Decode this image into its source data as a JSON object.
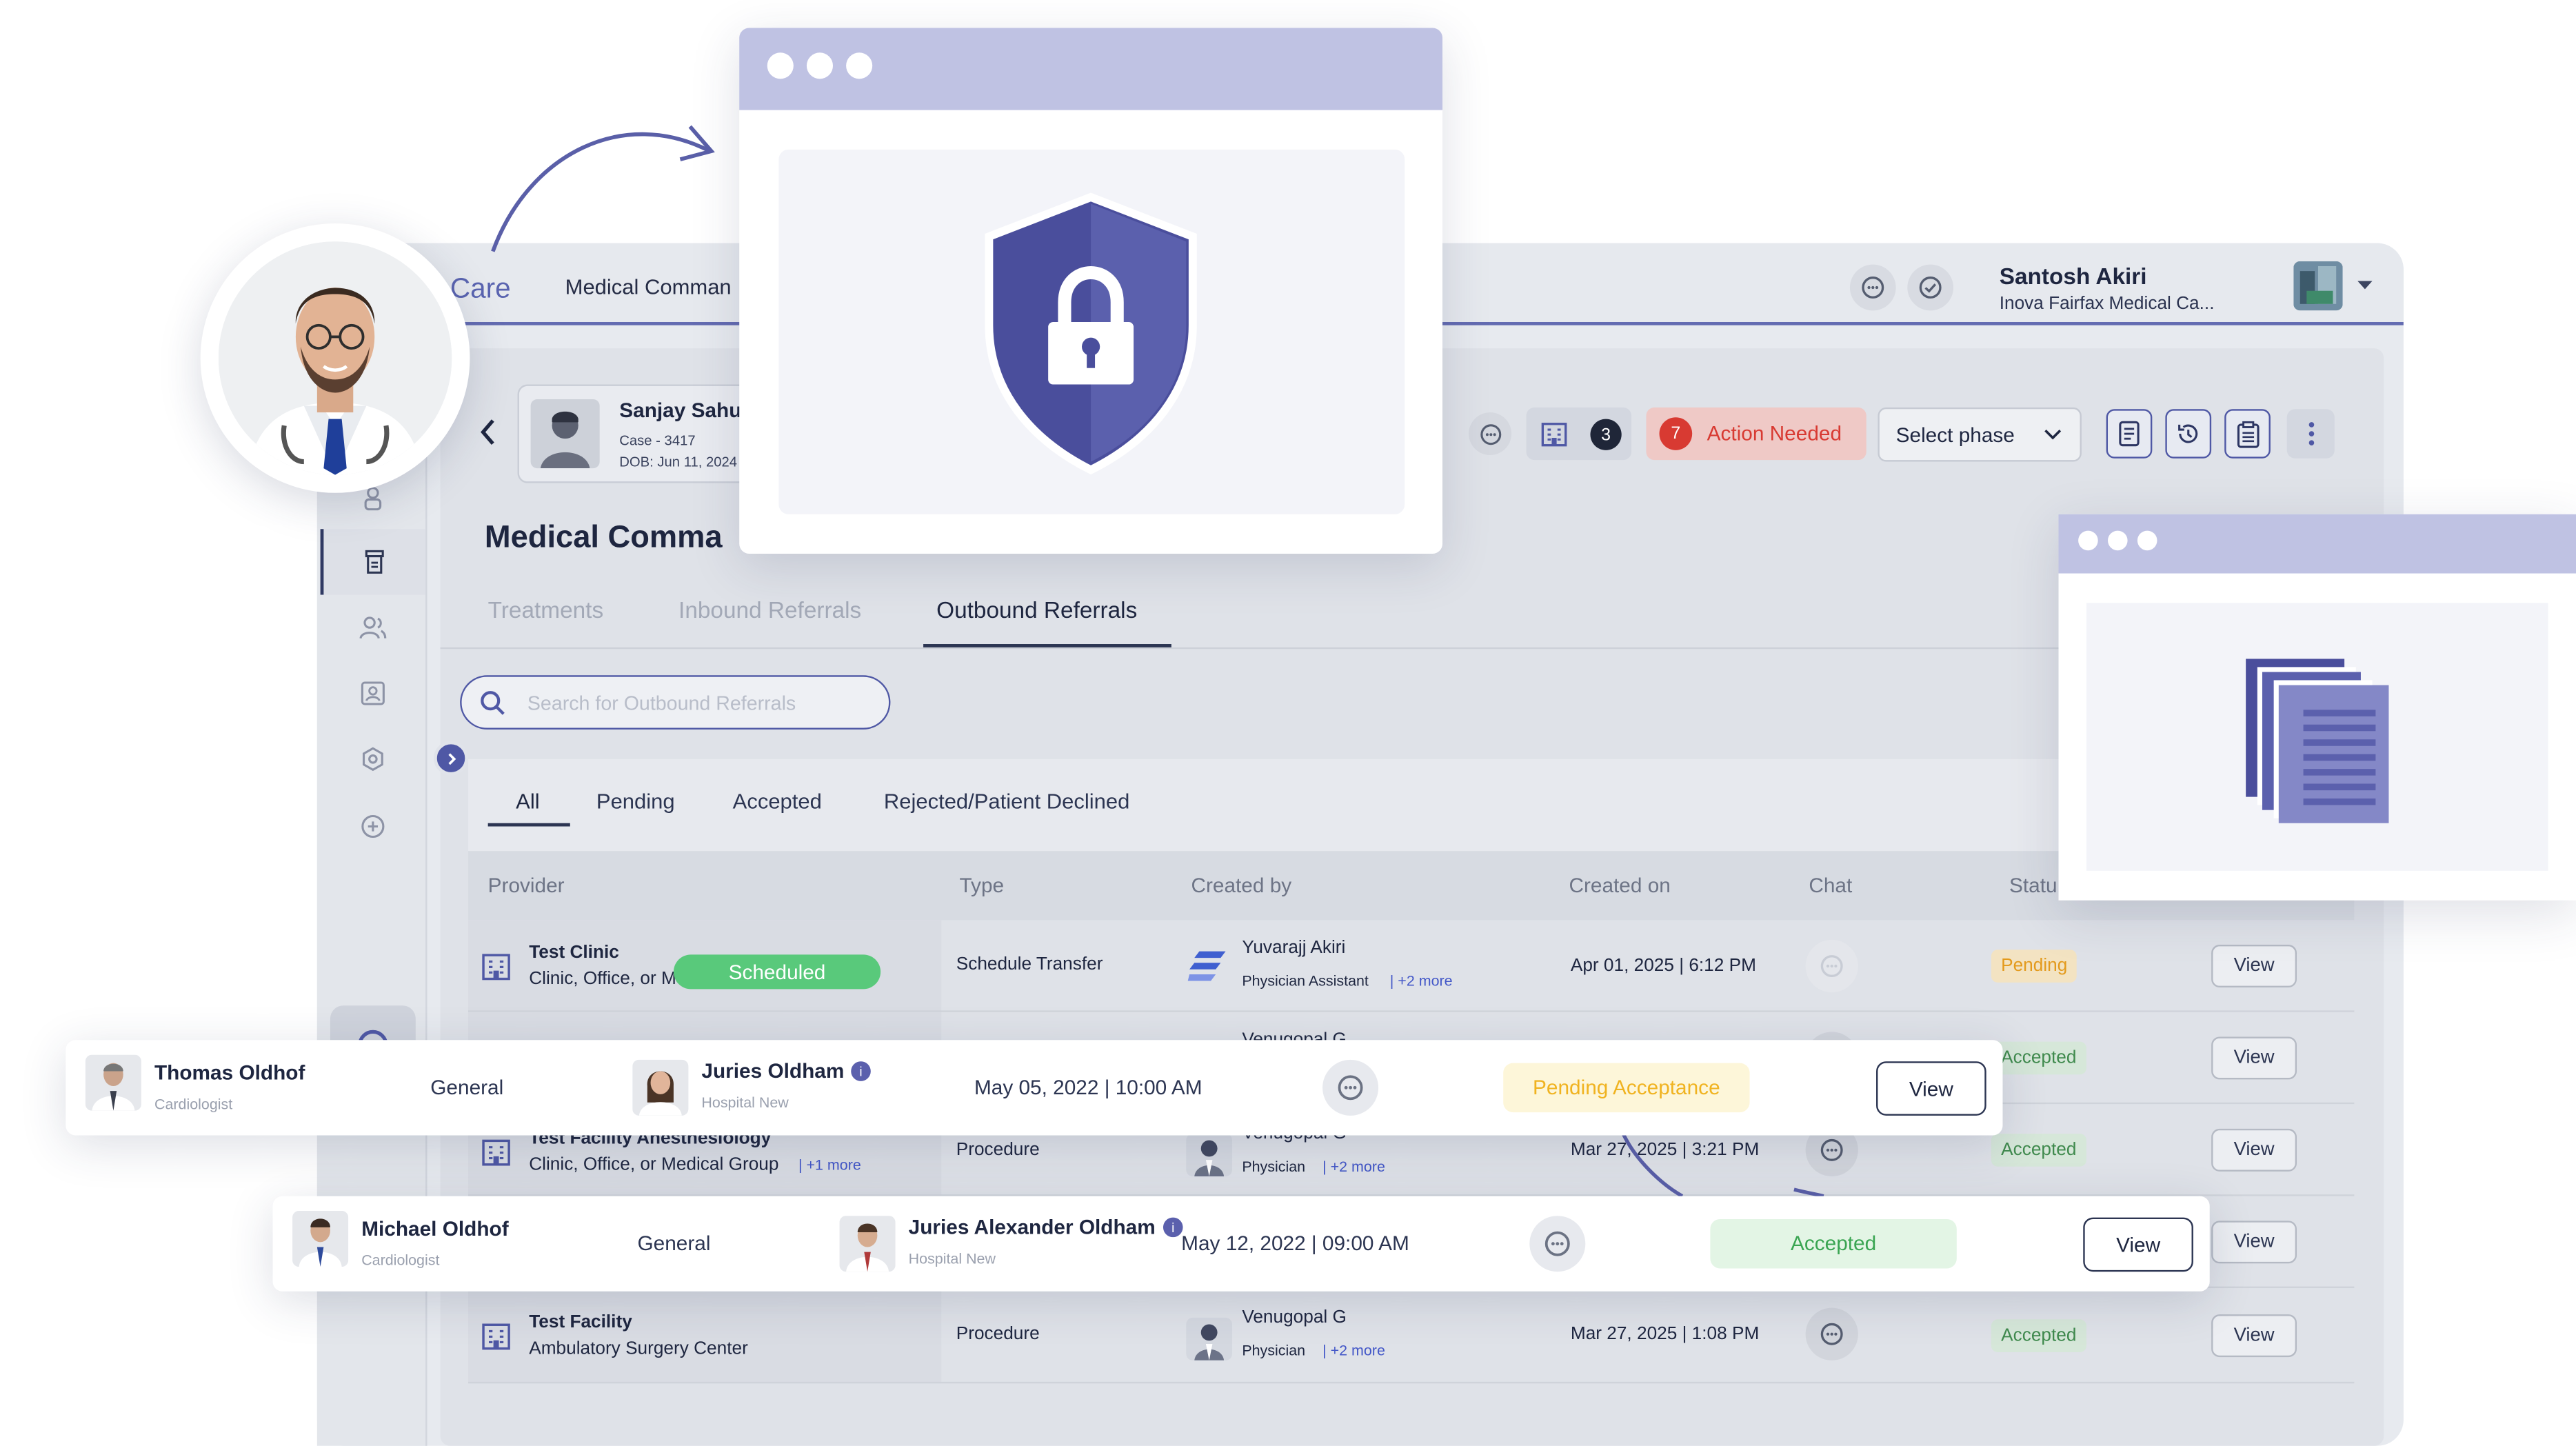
{
  "app": {
    "brand": "Care",
    "nav_title": "Medical Comman",
    "user": {
      "name": "Santosh Akiri",
      "org": "Inova Fairfax Medical Ca..."
    }
  },
  "patient": {
    "name": "Sanjay Sahu",
    "case": "Case - 3417",
    "dob": "DOB: Jun 11, 2024"
  },
  "toolbar": {
    "facility_count": "3",
    "action_count": "7",
    "action_label": "Action Needed",
    "phase_placeholder": "Select phase"
  },
  "page_title": "Medical Comma",
  "tabs": [
    "Treatments",
    "Inbound Referrals",
    "Outbound Referrals"
  ],
  "active_tab": "Outbound Referrals",
  "search": {
    "placeholder": "Search for Outbound Referrals"
  },
  "filters": [
    "All",
    "Pending",
    "Accepted",
    "Rejected/Patient Declined"
  ],
  "table": {
    "headers": [
      "Provider",
      "Type",
      "Created by",
      "Created on",
      "Chat",
      "Statu"
    ],
    "rows": [
      {
        "provider": "Test Clinic",
        "provider_type": "Clinic, Office, or M",
        "type": "Schedule Transfer",
        "created_by": "Yuvarajj Akiri",
        "role": "Physician Assistant",
        "more": "| +2 more",
        "created_on": "Apr 01, 2025 | 6:12 PM",
        "status": "Pending",
        "action": "View"
      },
      {
        "provider": "",
        "provider_type": "",
        "type": "",
        "created_by": "Venugopal G",
        "role": "",
        "more": "",
        "created_on": "",
        "status": "Accepted",
        "action": "View"
      },
      {
        "provider": "Test Facility Anesthesiology",
        "provider_type": "Clinic, Office, or Medical Group",
        "provider_more": "| +1 more",
        "type": "Procedure",
        "created_by": "Venugopal G",
        "role": "Physician",
        "more": "| +2 more",
        "created_on": "Mar 27, 2025 | 3:21 PM",
        "status": "Accepted",
        "action": "View"
      },
      {
        "provider": "",
        "provider_type": "",
        "type": "",
        "created_by": "",
        "role": "",
        "more": "",
        "created_on": "",
        "status": "",
        "action": "View"
      },
      {
        "provider": "Test Facility",
        "provider_type": "Ambulatory Surgery Center",
        "type": "Procedure",
        "created_by": "Venugopal G",
        "role": "Physician",
        "more": "| +2 more",
        "created_on": "Mar 27, 2025 | 1:08 PM",
        "status": "Accepted",
        "action": "View"
      }
    ]
  },
  "scheduled_badge": "Scheduled",
  "float_cards": [
    {
      "name": "Thomas Oldhof",
      "specialty": "Cardiologist",
      "type": "General",
      "doctor": "Juries Oldham",
      "hospital": "Hospital New",
      "date": "May 05, 2022 | 10:00 AM",
      "status": "Pending Acceptance",
      "action": "View"
    },
    {
      "name": "Michael Oldhof",
      "specialty": "Cardiologist",
      "type": "General",
      "doctor": "Juries Alexander Oldham",
      "hospital": "Hospital New",
      "date": "May 12, 2022 | 09:00 AM",
      "status": "Accepted",
      "action": "View"
    }
  ],
  "icons": [
    "chevron-left-icon",
    "hospital-building-icon",
    "chat-icon",
    "chevron-down-icon",
    "search-icon",
    "shield-lock-icon",
    "documents-icon",
    "kebab-menu-icon",
    "history-icon",
    "clipboard-icon",
    "document-icon"
  ],
  "colors": {
    "accent": "#4f58a5",
    "window_bar": "#bfc2e3",
    "shield": "#5b60ad",
    "scheduled": "#59c97b",
    "pending": "#f0a623",
    "accepted": "#3f8a4d",
    "action_needed": "#d83a32"
  }
}
